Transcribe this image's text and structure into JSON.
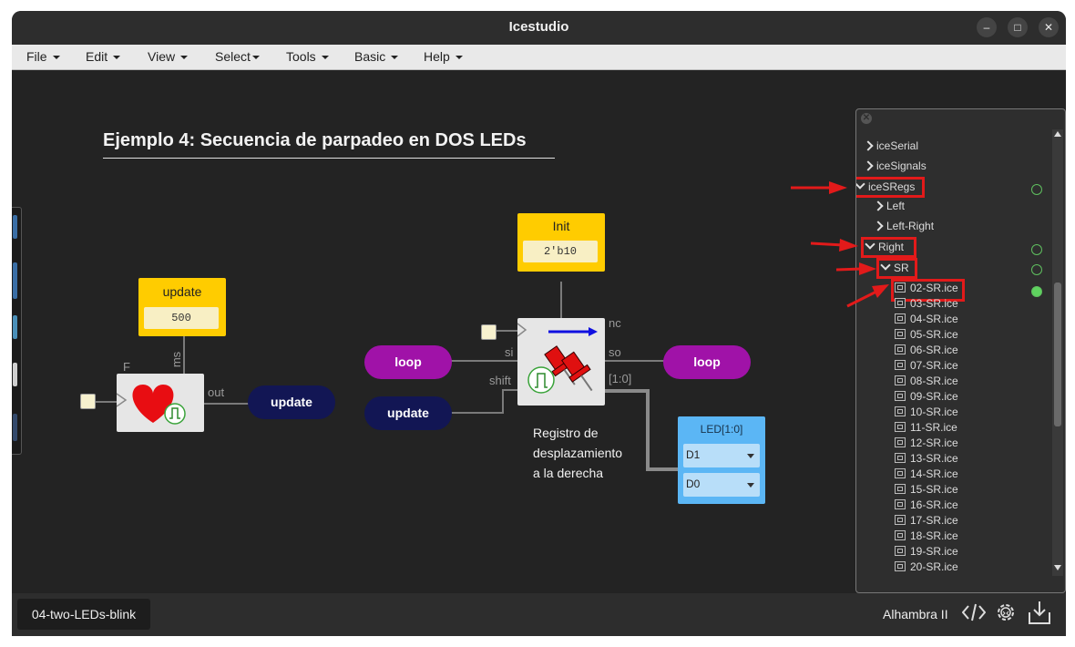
{
  "window": {
    "title": "Icestudio",
    "controls": [
      "–",
      "□",
      "✕"
    ]
  },
  "menu": [
    {
      "label": "File"
    },
    {
      "label": "Edit"
    },
    {
      "label": "View"
    },
    {
      "label": "Select"
    },
    {
      "label": "Tools"
    },
    {
      "label": "Basic"
    },
    {
      "label": "Help"
    }
  ],
  "canvas": {
    "heading": "Ejemplo 4: Secuencia de parpadeo en DOS LEDs",
    "update_const": {
      "title": "update",
      "value": "500"
    },
    "init_const": {
      "title": "Init",
      "value": "2'b10"
    },
    "heartbeat": {
      "port_f": "F",
      "port_ms": "ms",
      "port_out": "out"
    },
    "shift": {
      "port_si": "si",
      "port_shift": "shift",
      "port_nc": "nc",
      "port_so": "so",
      "port_bus": "[1:0]"
    },
    "labels": {
      "loop_left": "loop",
      "loop_right": "loop",
      "update_right": "update",
      "update_left": "update"
    },
    "comment": [
      "Registro de",
      "desplazamiento",
      "a la derecha"
    ],
    "led_block": {
      "title": "LED[1:0]",
      "pins": [
        "D1",
        "D0"
      ]
    }
  },
  "tree": {
    "items": [
      {
        "label": "iceSerial",
        "state": "collapsed",
        "level": 0
      },
      {
        "label": "iceSignals",
        "state": "collapsed",
        "level": 0
      },
      {
        "label": "iceSRegs",
        "state": "expanded",
        "level": 0
      },
      {
        "label": "Left",
        "state": "collapsed",
        "level": 1
      },
      {
        "label": "Left-Right",
        "state": "collapsed",
        "level": 1
      },
      {
        "label": "Right",
        "state": "expanded",
        "level": 1
      },
      {
        "label": "SR",
        "state": "expanded",
        "level": 2
      }
    ],
    "files": [
      "02-SR.ice",
      "03-SR.ice",
      "04-SR.ice",
      "05-SR.ice",
      "06-SR.ice",
      "07-SR.ice",
      "08-SR.ice",
      "09-SR.ice",
      "10-SR.ice",
      "11-SR.ice",
      "12-SR.ice",
      "13-SR.ice",
      "14-SR.ice",
      "15-SR.ice",
      "16-SR.ice",
      "17-SR.ice",
      "18-SR.ice",
      "19-SR.ice",
      "20-SR.ice"
    ]
  },
  "footer": {
    "tab": "04-two-LEDs-blink",
    "board": "Alhambra II",
    "icons": [
      "code-icon",
      "gear-icon",
      "download-icon"
    ]
  },
  "colors": {
    "const_yellow": "#ffcc00",
    "pill_purple": "#a012a8",
    "pill_navy": "#121654",
    "led_blue": "#5bb6f5",
    "highlight_red": "#e21a1a"
  }
}
